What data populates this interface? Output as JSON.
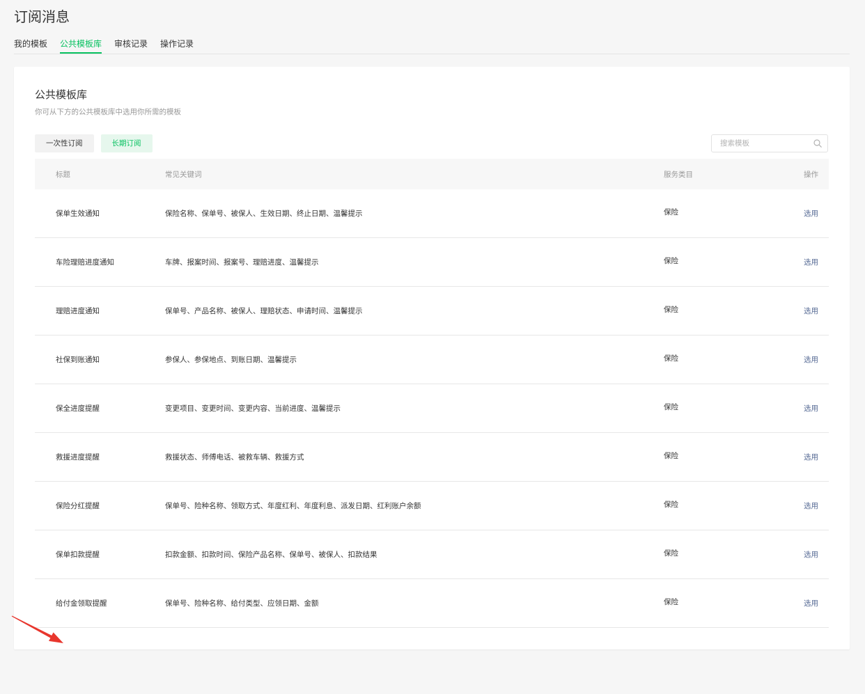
{
  "page": {
    "title": "订阅消息"
  },
  "tabs": [
    {
      "label": "我的模板",
      "active": false
    },
    {
      "label": "公共模板库",
      "active": true
    },
    {
      "label": "审核记录",
      "active": false
    },
    {
      "label": "操作记录",
      "active": false
    }
  ],
  "panel": {
    "title": "公共模板库",
    "subtitle": "你可从下方的公共模板库中选用你所需的模板"
  },
  "filters": [
    {
      "label": "一次性订阅",
      "active": false
    },
    {
      "label": "长期订阅",
      "active": true
    }
  ],
  "search": {
    "placeholder": "搜索模板"
  },
  "table": {
    "columns": [
      "标题",
      "常见关键词",
      "服务类目",
      "操作"
    ],
    "rows": [
      {
        "title": "保单生效通知",
        "keywords": "保险名称、保单号、被保人、生效日期、终止日期、温馨提示",
        "category": "保险",
        "action": "选用"
      },
      {
        "title": "车险理赔进度通知",
        "keywords": "车牌、报案时间、报案号、理赔进度、温馨提示",
        "category": "保险",
        "action": "选用"
      },
      {
        "title": "理赔进度通知",
        "keywords": "保单号、产品名称、被保人、理赔状态、申请时间、温馨提示",
        "category": "保险",
        "action": "选用"
      },
      {
        "title": "社保到账通知",
        "keywords": "参保人、参保地点、到账日期、温馨提示",
        "category": "保险",
        "action": "选用"
      },
      {
        "title": "保全进度提醒",
        "keywords": "变更项目、变更时间、变更内容、当前进度、温馨提示",
        "category": "保险",
        "action": "选用"
      },
      {
        "title": "救援进度提醒",
        "keywords": "救援状态、师傅电话、被救车辆、救援方式",
        "category": "保险",
        "action": "选用"
      },
      {
        "title": "保险分红提醒",
        "keywords": "保单号、险种名称、领取方式、年度红利、年度利息、派发日期、红利账户余额",
        "category": "保险",
        "action": "选用"
      },
      {
        "title": "保单扣款提醒",
        "keywords": "扣款金额、扣款时间、保险产品名称、保单号、被保人、扣款结果",
        "category": "保险",
        "action": "选用"
      },
      {
        "title": "给付金领取提醒",
        "keywords": "保单号、险种名称、给付类型、应领日期、金额",
        "category": "保险",
        "action": "选用"
      }
    ]
  },
  "colors": {
    "accent": "#07c160",
    "accent_background": "#e6f7ed",
    "link": "#576b95",
    "annotation": "#e8362d",
    "page_background": "#f6f6f6"
  },
  "icons": {
    "search": "search-icon",
    "annotation": "arrow-annotation"
  }
}
